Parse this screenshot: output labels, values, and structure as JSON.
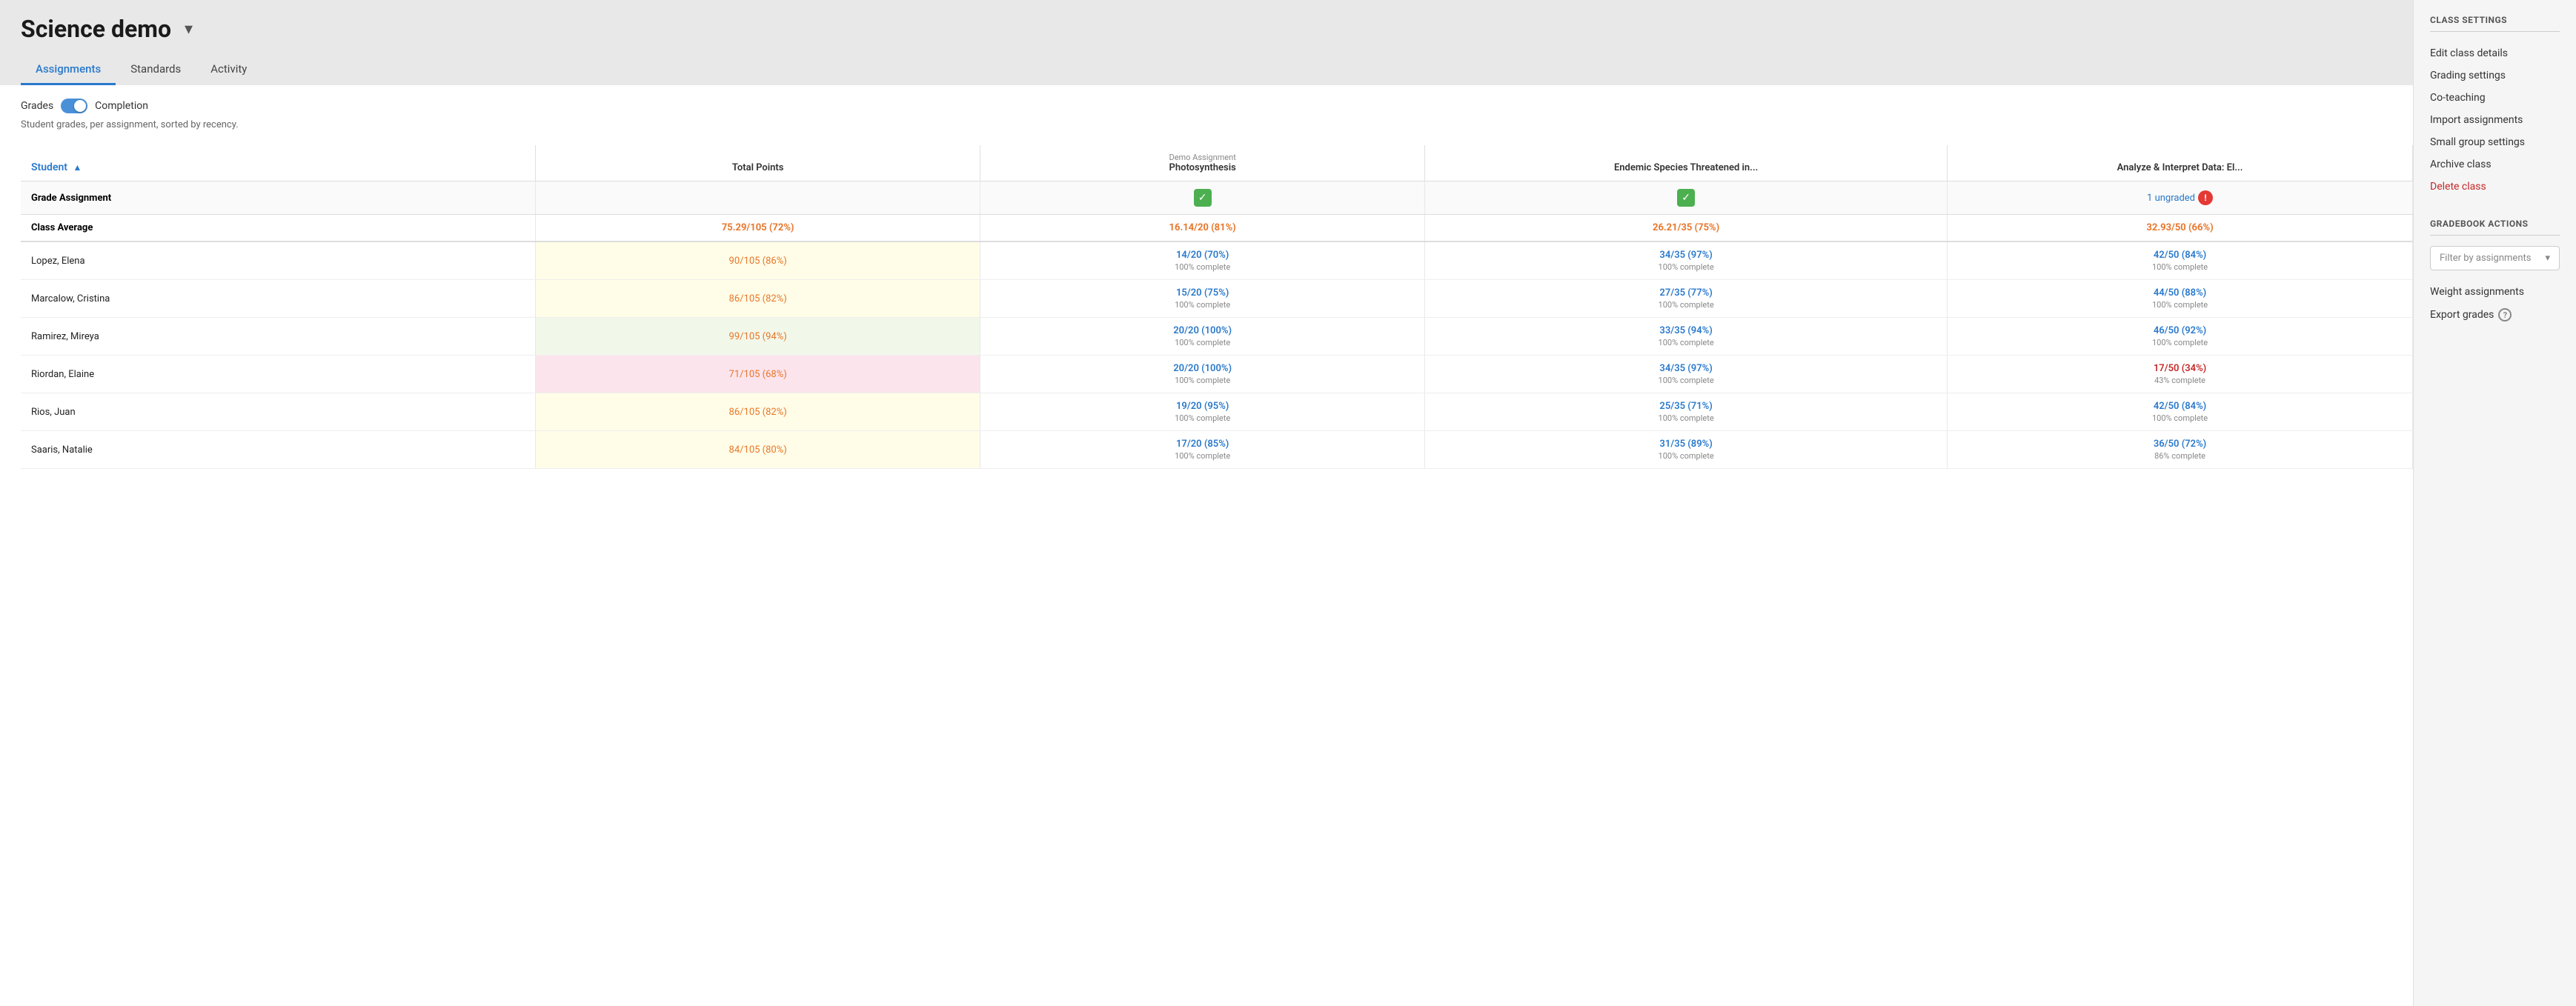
{
  "header": {
    "class_title": "Science demo",
    "chevron": "▾",
    "tabs": [
      {
        "label": "Assignments",
        "active": true
      },
      {
        "label": "Standards",
        "active": false
      },
      {
        "label": "Activity",
        "active": false
      }
    ]
  },
  "controls": {
    "grades_label": "Grades",
    "completion_label": "Completion",
    "subtext": "Student grades, per assignment, sorted by recency."
  },
  "table": {
    "columns": {
      "student": "Student",
      "total_points": "Total Points",
      "col1_sub": "Demo Assignment",
      "col1_main": "Photosynthesis",
      "col2_main": "Endemic Species Threatened in...",
      "col3_main": "Analyze & Interpret Data: El..."
    },
    "grade_assignment_row": {
      "col1_checkmark": "✓",
      "col2_checkmark": "✓",
      "col3_ungraded": "1 ungraded",
      "col3_warning": "!"
    },
    "class_average": {
      "label": "Class Average",
      "total": "75.29/105 (72%)",
      "col1": "16.14/20 (81%)",
      "col2": "26.21/35 (75%)",
      "col3": "32.93/50 (66%)"
    },
    "students": [
      {
        "name": "Lopez, Elena",
        "total": "90/105 (86%)",
        "total_bg": "bg-yellow",
        "col1_main": "14/20 (70%)",
        "col1_sub": "100% complete",
        "col2_main": "34/35 (97%)",
        "col2_sub": "100% complete",
        "col3_main": "42/50 (84%)",
        "col3_sub": "100% complete"
      },
      {
        "name": "Marcalow, Cristina",
        "total": "86/105 (82%)",
        "total_bg": "bg-yellow",
        "col1_main": "15/20 (75%)",
        "col1_sub": "100% complete",
        "col2_main": "27/35 (77%)",
        "col2_sub": "100% complete",
        "col3_main": "44/50 (88%)",
        "col3_sub": "100% complete"
      },
      {
        "name": "Ramirez, Mireya",
        "total": "99/105 (94%)",
        "total_bg": "bg-green",
        "col1_main": "20/20 (100%)",
        "col1_sub": "100% complete",
        "col2_main": "33/35 (94%)",
        "col2_sub": "100% complete",
        "col3_main": "46/50 (92%)",
        "col3_sub": "100% complete"
      },
      {
        "name": "Riordan, Elaine",
        "total": "71/105 (68%)",
        "total_bg": "bg-pink",
        "col1_main": "20/20 (100%)",
        "col1_sub": "100% complete",
        "col2_main": "34/35 (97%)",
        "col2_sub": "100% complete",
        "col3_main": "17/50 (34%)",
        "col3_sub": "43% complete",
        "col3_red": true
      },
      {
        "name": "Rios, Juan",
        "total": "86/105 (82%)",
        "total_bg": "bg-yellow",
        "col1_main": "19/20 (95%)",
        "col1_sub": "100% complete",
        "col2_main": "25/35 (71%)",
        "col2_sub": "100% complete",
        "col3_main": "42/50 (84%)",
        "col3_sub": "100% complete"
      },
      {
        "name": "Saaris, Natalie",
        "total": "84/105 (80%)",
        "total_bg": "bg-yellow",
        "col1_main": "17/20 (85%)",
        "col1_sub": "100% complete",
        "col2_main": "31/35 (89%)",
        "col2_sub": "100% complete",
        "col3_main": "36/50 (72%)",
        "col3_sub": "86% complete"
      }
    ]
  },
  "sidebar": {
    "class_settings_title": "CLASS SETTINGS",
    "class_settings_links": [
      {
        "label": "Edit class details",
        "red": false
      },
      {
        "label": "Grading settings",
        "red": false
      },
      {
        "label": "Co-teaching",
        "red": false
      },
      {
        "label": "Import assignments",
        "red": false
      },
      {
        "label": "Small group settings",
        "red": false
      },
      {
        "label": "Archive class",
        "red": false
      },
      {
        "label": "Delete class",
        "red": true
      }
    ],
    "gradebook_actions_title": "GRADEBOOK ACTIONS",
    "filter_placeholder": "Filter by assignments",
    "gradebook_actions_links": [
      {
        "label": "Weight assignments",
        "has_help": false
      },
      {
        "label": "Export grades",
        "has_help": true
      }
    ]
  }
}
